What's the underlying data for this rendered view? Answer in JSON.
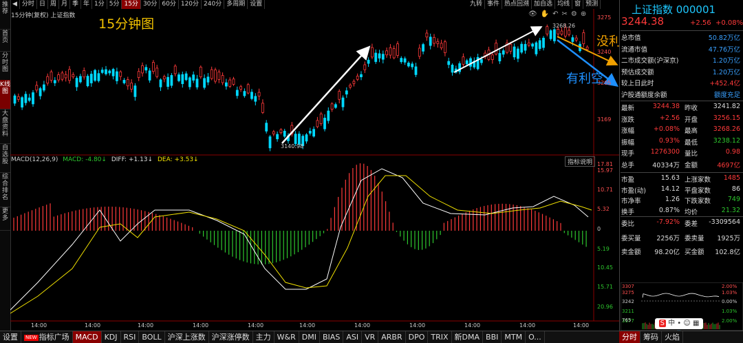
{
  "sidebar": {
    "items": [
      "推荐",
      "首页",
      "分时图",
      "K线图",
      "大盘资料",
      "自选股",
      "综合排名",
      "更多"
    ]
  },
  "toolbar": {
    "items": [
      "◀",
      "分时",
      "日",
      "周",
      "月",
      "季",
      "年",
      "1分",
      "5分",
      "15分",
      "30分",
      "60分",
      "120分",
      "240分",
      "多周期",
      "设置"
    ],
    "active": "15分",
    "right": [
      "九转",
      "事件",
      "热点回溯",
      "加自选",
      "均线",
      "窗",
      "预测"
    ]
  },
  "chart": {
    "title": "15分钟(复权)  上证指数",
    "annotation_15": "15分钟图",
    "annotation_no_bad": "没利空",
    "annotation_good": "有利空",
    "high_label": "3268.26",
    "low_label": "3140.98",
    "price_axis": [
      "3275",
      "3240",
      "3205",
      "3169"
    ],
    "macd_axis": [
      "17.81",
      "15.97",
      "10.71",
      "5.32",
      "0",
      "5.19",
      "10.45",
      "15.71",
      "20.96"
    ],
    "time_labels": [
      "14:00",
      "14:00",
      "14:00",
      "14:00",
      "14:00",
      "14:00",
      "14:00",
      "14:00",
      "14:00",
      "14:00",
      "14:00"
    ]
  },
  "macd": {
    "label": "MACD(12,26,9)",
    "macd": "MACD: -4.80↓",
    "diff": "DIFF: +1.13↓",
    "dea": "DEA: +3.53↓",
    "explain": "指标说明"
  },
  "index": {
    "name": "上证指数 000001",
    "price": "3244.38",
    "change": "+2.56",
    "pct": "+0.08%"
  },
  "panel_top": [
    {
      "label": "总市值",
      "value": "50.82万亿",
      "color": "blu"
    },
    {
      "label": "流通市值",
      "value": "47.76万亿",
      "color": "blu"
    },
    {
      "label": "二市成交额(沪深京)",
      "value": "1.20万亿",
      "color": "blu"
    },
    {
      "label": "预估成交额",
      "value": "1.20万亿",
      "color": "blu"
    },
    {
      "label": "较上日此时",
      "value": "+452.4亿",
      "color": "red"
    },
    {
      "label": "沪股通额度余额",
      "value": "额度充足",
      "color": "blu"
    }
  ],
  "quotes": [
    {
      "l1": "最新",
      "v1": "3244.38",
      "c1": "red",
      "l2": "昨收",
      "v2": "3241.82",
      "c2": "wht"
    },
    {
      "l1": "涨跌",
      "v1": "+2.56",
      "c1": "red",
      "l2": "开盘",
      "v2": "3256.15",
      "c2": "red"
    },
    {
      "l1": "涨幅",
      "v1": "+0.08%",
      "c1": "red",
      "l2": "最高",
      "v2": "3268.26",
      "c2": "red"
    },
    {
      "l1": "振幅",
      "v1": "0.93%",
      "c1": "red",
      "l2": "最低",
      "v2": "3238.12",
      "c2": "grn"
    },
    {
      "l1": "现手",
      "v1": "1276300",
      "c1": "red",
      "l2": "量比",
      "v2": "0.98",
      "c2": "red"
    },
    {
      "l1": "总手",
      "v1": "40334万",
      "c1": "wht",
      "l2": "金额",
      "v2": "4697亿",
      "c2": "red"
    }
  ],
  "stats": [
    {
      "l1": "市盈",
      "v1": "15.63",
      "l2": "上涨家数",
      "v2": "1485",
      "c2": "red"
    },
    {
      "l1": "市盈(动)",
      "v1": "14.12",
      "l2": "平盘家数",
      "v2": "86",
      "c2": "wht"
    },
    {
      "l1": "市净率",
      "v1": "1.26",
      "l2": "下跌家数",
      "v2": "749",
      "c2": "grn"
    },
    {
      "l1": "换手",
      "v1": "0.87%",
      "l2": "均价",
      "v2": "21.32",
      "c2": "grn"
    }
  ],
  "orders": [
    {
      "l1": "委比",
      "v1": "-7.92%",
      "c1": "red",
      "l2": "委差",
      "v2": "-3309564",
      "c2": "wht"
    },
    {
      "l1": "委买量",
      "v1": "2256万",
      "c1": "wht",
      "l2": "委卖量",
      "v2": "1925万",
      "c2": "wht"
    },
    {
      "l1": "卖金额",
      "v1": "98.20亿",
      "c1": "wht",
      "l2": "买金额",
      "v2": "102.8亿",
      "c2": "wht"
    }
  ],
  "mini": {
    "prices": [
      "3307",
      "3275",
      "3242",
      "3211",
      "3177"
    ],
    "pct": [
      "2.00%",
      "1.03%",
      "0.00%",
      "1.03%",
      "2.00%"
    ],
    "vol": "765"
  },
  "bottom_tabs": {
    "items": [
      "设置",
      "指标广场",
      "MACD",
      "KDJ",
      "RSI",
      "BOLL",
      "沪深上涨数",
      "沪深涨停数",
      "主力",
      "W&R",
      "DMI",
      "BIAS",
      "ASI",
      "VR",
      "ARBR",
      "DPO",
      "TRIX",
      "新DMA",
      "BBI",
      "MTM",
      "O..."
    ],
    "new_badge": "NEW",
    "active": "MACD",
    "right": [
      "分时",
      "筹码",
      "火焰"
    ]
  }
}
